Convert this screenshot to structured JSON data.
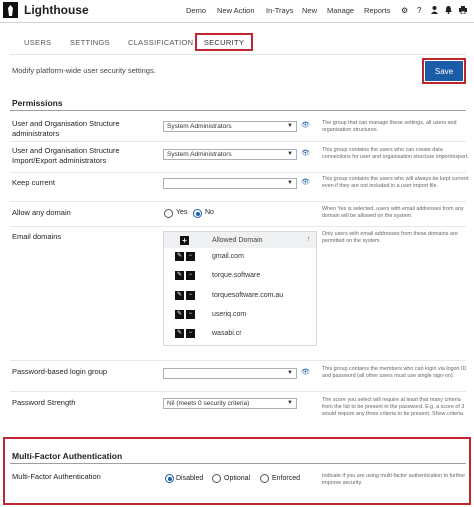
{
  "header": {
    "app_name": "Lighthouse",
    "nav": [
      "Demo",
      "New Action",
      "In-Trays",
      "New",
      "Manage",
      "Reports"
    ],
    "icons": [
      "gear-icon",
      "help-icon",
      "user-icon",
      "bell-icon",
      "print-icon"
    ]
  },
  "tabs": [
    "USERS",
    "SETTINGS",
    "CLASSIFICATION",
    "SECURITY"
  ],
  "active_tab": "SECURITY",
  "page_description": "Modify platform-wide user security settings.",
  "save_label": "Save",
  "permissions": {
    "title": "Permissions",
    "user_org_admins": {
      "label": "User and Organisation Structure administrators",
      "value": "System Administrators",
      "help": "The group that can manage these settings, all users and organisation structures."
    },
    "import_export_admins": {
      "label": "User and Organisation Structure Import/Export administrators",
      "value": "System Administrators",
      "help": "This group contains the users who can create data connections for user and organisation structure import/export."
    },
    "keep_current": {
      "label": "Keep current",
      "value": "",
      "help": "This group contains the users who will always be kept current even if they are not included in a user import file."
    },
    "allow_any_domain": {
      "label": "Allow any domain",
      "options": [
        "Yes",
        "No"
      ],
      "selected": "No",
      "help": "When Yes is selected, users with email addresses from any domain will be allowed on the system."
    },
    "email_domains": {
      "label": "Email domains",
      "column": "Allowed Domain",
      "rows": [
        "gmail.com",
        "torque.software",
        "torquesoftware.com.au",
        "useriq.com",
        "wasabi.cr"
      ],
      "help": "Only users with email addresses from these domains are permitted on the system."
    },
    "password_login_group": {
      "label": "Password-based login group",
      "value": "",
      "help": "This group contains the members who can login via logon ID and password (all other users must use single sign-on)."
    },
    "password_strength": {
      "label": "Password Strength",
      "value": "Nil (meets 0 security criteria)",
      "help": "The score you select will require at least that many criteria from the list to be present in the password. E.g. a score of 3 would require any three criteria to be present. Show criteria"
    }
  },
  "mfa": {
    "title": "Multi-Factor Authentication",
    "label": "Multi-Factor Authentication",
    "options": [
      "Disabled",
      "Optional",
      "Enforced"
    ],
    "selected": "Disabled",
    "help": "Indicate if you are using multi-factor authentication to further improve security."
  },
  "colors": {
    "accent": "#1a5ca8",
    "highlight_border": "#c0262d"
  }
}
